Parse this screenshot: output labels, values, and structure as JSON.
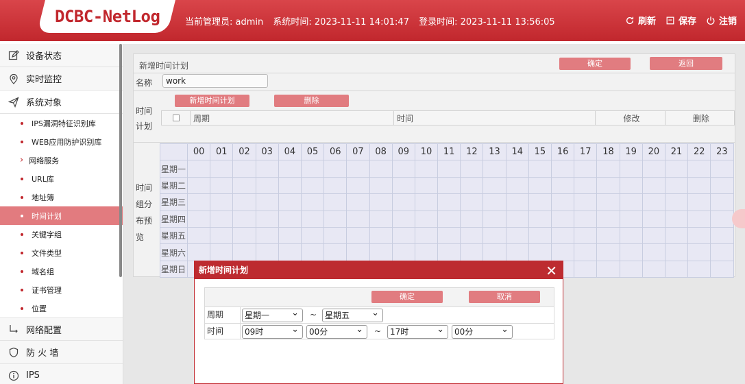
{
  "header": {
    "logo": "DCBC-NetLog",
    "admin_label": "当前管理员: admin",
    "system_time": "系统时间: 2023-11-11 14:01:47",
    "login_time": "登录时间: 2023-11-11 13:56:05",
    "refresh": "刷新",
    "save": "保存",
    "logout": "注销"
  },
  "sidebar": {
    "items": [
      {
        "label": "设备状态",
        "icon": "edit-icon"
      },
      {
        "label": "实时监控",
        "icon": "location-icon"
      },
      {
        "label": "系统对象",
        "icon": "send-icon"
      }
    ],
    "sub_items": [
      "IPS漏洞特征识别库",
      "WEB应用防护识别库",
      "网络服务",
      "URL库",
      "地址簿",
      "时间计划",
      "关键字组",
      "文件类型",
      "域名组",
      "证书管理",
      "位置"
    ],
    "active_sub": "时间计划",
    "bottom_items": [
      {
        "label": "网络配置",
        "icon": "network-icon"
      },
      {
        "label": "防 火 墙",
        "icon": "shield-icon"
      },
      {
        "label": "IPS",
        "icon": "info-icon"
      }
    ]
  },
  "panel": {
    "title": "新增时间计划",
    "confirm": "确定",
    "back": "返回",
    "name_label": "名称",
    "name_value": "work",
    "plan_label_1": "时间",
    "plan_label_2": "计划",
    "add_plan": "新增时间计划",
    "delete": "删除",
    "col_period": "周期",
    "col_time": "时间",
    "col_edit": "修改",
    "col_delete": "删除",
    "preview_label": [
      "时间",
      "组分",
      "布预",
      "览"
    ],
    "hours": [
      "00",
      "01",
      "02",
      "03",
      "04",
      "05",
      "06",
      "07",
      "08",
      "09",
      "10",
      "11",
      "12",
      "13",
      "14",
      "15",
      "16",
      "17",
      "18",
      "19",
      "20",
      "21",
      "22",
      "23"
    ],
    "days": [
      "星期一",
      "星期二",
      "星期三",
      "星期四",
      "星期五",
      "星期六",
      "星期日"
    ]
  },
  "modal": {
    "title": "新增时间计划",
    "close": "✕",
    "confirm": "确定",
    "cancel": "取消",
    "period_label": "周期",
    "period_from": "星期一",
    "period_to": "星期五",
    "time_label": "时间",
    "start_hour": "09时",
    "start_min": "00分",
    "end_hour": "17时",
    "end_min": "00分",
    "tilde": "~"
  }
}
